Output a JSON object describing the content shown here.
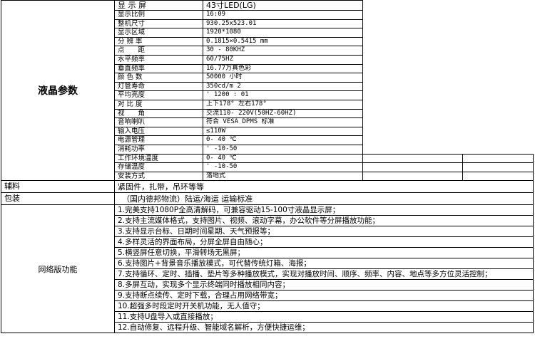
{
  "lcd": {
    "group_label": "液晶参数",
    "rows": [
      {
        "label": "显 示 屏",
        "value": "43寸LED(LG)"
      },
      {
        "label": "显示比例",
        "value": "16:09"
      },
      {
        "label": "整机尺寸",
        "value": "930.25x523.01"
      },
      {
        "label": "显示区域",
        "value": "1920*1080"
      },
      {
        "label": "分 辨 率",
        "value": "0.1815×0.5415 mm"
      },
      {
        "label": "点　　距",
        "value": "30 - 80KHZ"
      },
      {
        "label": "水平频率",
        "value": "60/75HZ"
      },
      {
        "label": "垂直频率",
        "value": "16.77万真色彩"
      },
      {
        "label": "颜 色 数",
        "value": "50000 小时"
      },
      {
        "label": "灯管寿命",
        "value": "350cd/m 2"
      },
      {
        "label": "平均亮度",
        "value": "' 1200 : 01"
      },
      {
        "label": "对 比 度",
        "value": "上下178° 左右178°"
      },
      {
        "label": "视　　角",
        "value": "交流110- 220V(50HZ-60HZ)"
      },
      {
        "label": "音响喇叭",
        "value": "符合 VESA DPMS 标准"
      },
      {
        "label": "输入电压",
        "value": "≤110W"
      },
      {
        "label": "电源管理",
        "value": "0- 40 ℃"
      },
      {
        "label": "消耗功率",
        "value": "' -10-50"
      },
      {
        "label": "工作环境温度",
        "value": "0- 40 ℃"
      },
      {
        "label": "存储温度",
        "value": "' -10-50"
      },
      {
        "label": "安装方式",
        "value": "落地式"
      }
    ]
  },
  "accessories": {
    "label": "辅料",
    "value": "紧固件，扎带，吊环等等"
  },
  "packaging": {
    "label": "包装",
    "value": "（国内德邦物流）陆运/海运 运输标准"
  },
  "network": {
    "label": "网络版功能",
    "items": [
      "1.完美支持1080P全高清解码，可兼容驱动15-100寸液晶显示屏；",
      "2.支持主流媒体格式，支持图片、视频、滚动字幕，办公软件等分屏播放功能；",
      "3.支持显示台标、日期时间星期、天气预报等；",
      "4.多样灵活的界面布局，分屏全屏自由随心；",
      "5.横竖屏任意切换，平滑转场无黑屏；",
      "6.支持图片+背景音乐播放模式，可代替传统灯箱、海报；",
      "7.支持循环、定时、插播、垫片等多种播放模式，实现对播放时间、顺序、频率、内容、地点等多方位灵活控制；",
      "8.多屏互动，实现多个显示终端同时播放相同内容；",
      "9.支持断点续传、定时下载，合理占用网络带宽；",
      "10.超强多时段定时开关机功能，无人值守；",
      "11.支持U盘导入或直接播放；",
      "12.自动修复、远程升级、智能域名解析，方便快捷运维；"
    ]
  }
}
